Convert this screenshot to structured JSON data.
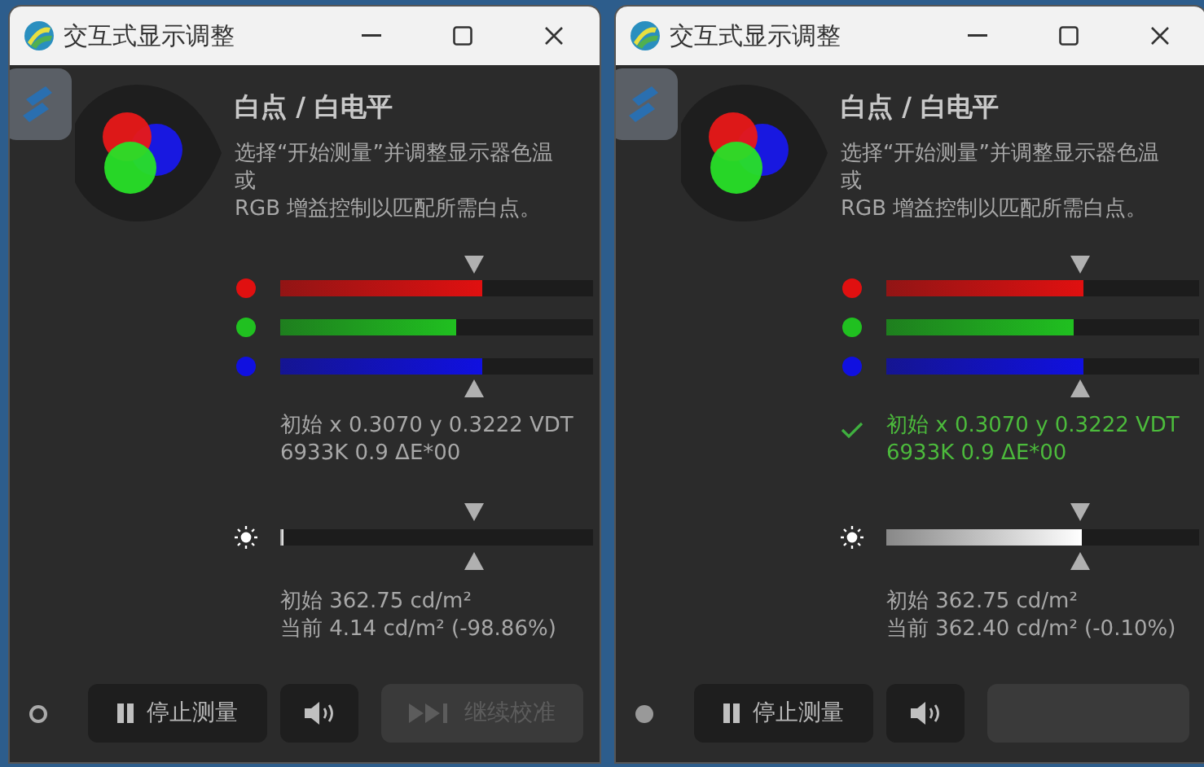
{
  "windows": [
    {
      "title": "交互式显示调整",
      "heading": "白点 / 白电平",
      "description": [
        "选择“开始测量”并调整显示器色温",
        "或",
        "RGB 增益控制以匹配所需白点。"
      ],
      "channels": [
        {
          "color": "#e01010",
          "level": 0.645
        },
        {
          "color": "#20c020",
          "level": 0.56
        },
        {
          "color": "#1010e0",
          "level": 0.645
        }
      ],
      "chromaticity": {
        "matched": false,
        "lines": [
          "初始 x 0.3070 y 0.3222 VDT",
          "6933K 0.9 ΔE*00"
        ]
      },
      "luminance": {
        "level": 0.01,
        "lines": [
          "初始 362.75 cd/m²",
          "当前 4.14 cd/m² (-98.86%)"
        ]
      },
      "status_filled": false,
      "stop_button": "停止测量",
      "continue_button": {
        "label": "继续校准",
        "disabled": true
      }
    },
    {
      "title": "交互式显示调整",
      "heading": "白点 / 白电平",
      "description": [
        "选择“开始测量”并调整显示器色温",
        "或",
        "RGB 增益控制以匹配所需白点。"
      ],
      "channels": [
        {
          "color": "#e01010",
          "level": 0.63
        },
        {
          "color": "#20c020",
          "level": 0.6
        },
        {
          "color": "#1010e0",
          "level": 0.63
        }
      ],
      "chromaticity": {
        "matched": true,
        "lines": [
          "初始 x 0.3070 y 0.3222 VDT",
          "6933K 0.9 ΔE*00"
        ]
      },
      "luminance": {
        "level": 0.625,
        "lines": [
          "初始 362.75 cd/m²",
          "当前 362.40 cd/m² (-0.10%)"
        ]
      },
      "status_filled": true,
      "stop_button": "停止测量",
      "continue_button": {
        "disabled": true
      }
    }
  ]
}
